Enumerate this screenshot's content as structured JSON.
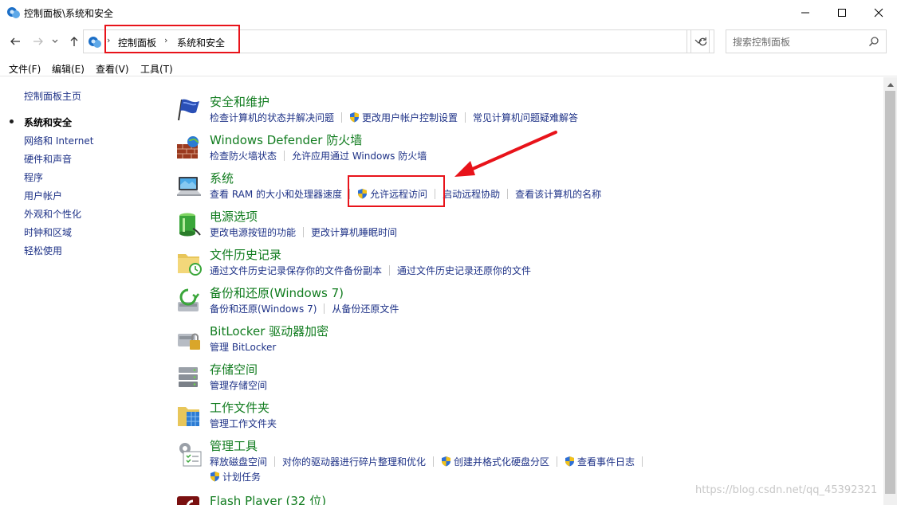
{
  "window": {
    "title": "控制面板\\系统和安全"
  },
  "address": {
    "crumbs": [
      "控制面板",
      "系统和安全"
    ],
    "search_placeholder": "搜索控制面板"
  },
  "menu": [
    "文件(F)",
    "编辑(E)",
    "查看(V)",
    "工具(T)"
  ],
  "sidebar": {
    "home": "控制面板主页",
    "items": [
      {
        "label": "系统和安全",
        "current": true
      },
      {
        "label": "网络和 Internet"
      },
      {
        "label": "硬件和声音"
      },
      {
        "label": "程序"
      },
      {
        "label": "用户帐户"
      },
      {
        "label": "外观和个性化"
      },
      {
        "label": "时钟和区域"
      },
      {
        "label": "轻松使用"
      }
    ]
  },
  "categories": [
    {
      "title": "安全和维护",
      "links": [
        {
          "label": "检查计算机的状态并解决问题"
        },
        {
          "label": "更改用户帐户控制设置",
          "shield": true
        },
        {
          "label": "常见计算机问题疑难解答"
        }
      ]
    },
    {
      "title": "Windows Defender 防火墙",
      "links": [
        {
          "label": "检查防火墙状态"
        },
        {
          "label": "允许应用通过 Windows 防火墙"
        }
      ]
    },
    {
      "title": "系统",
      "links": [
        {
          "label": "查看 RAM 的大小和处理器速度"
        },
        {
          "label": "允许远程访问",
          "shield": true
        },
        {
          "label": "启动远程协助"
        },
        {
          "label": "查看该计算机的名称"
        }
      ]
    },
    {
      "title": "电源选项",
      "links": [
        {
          "label": "更改电源按钮的功能"
        },
        {
          "label": "更改计算机睡眠时间"
        }
      ]
    },
    {
      "title": "文件历史记录",
      "links": [
        {
          "label": "通过文件历史记录保存你的文件备份副本"
        },
        {
          "label": "通过文件历史记录还原你的文件"
        }
      ]
    },
    {
      "title": "备份和还原(Windows 7)",
      "links": [
        {
          "label": "备份和还原(Windows 7)"
        },
        {
          "label": "从备份还原文件"
        }
      ]
    },
    {
      "title": "BitLocker 驱动器加密",
      "links": [
        {
          "label": "管理 BitLocker"
        }
      ]
    },
    {
      "title": "存储空间",
      "links": [
        {
          "label": "管理存储空间"
        }
      ]
    },
    {
      "title": "工作文件夹",
      "links": [
        {
          "label": "管理工作文件夹"
        }
      ]
    },
    {
      "title": "管理工具",
      "links": [
        {
          "label": "释放磁盘空间"
        },
        {
          "label": "对你的驱动器进行碎片整理和优化"
        },
        {
          "label": "创建并格式化硬盘分区",
          "shield": true
        },
        {
          "label": "查看事件日志",
          "shield": true
        }
      ],
      "links2": [
        {
          "label": "计划任务",
          "shield": true
        }
      ]
    },
    {
      "title": "Flash Player (32 位)",
      "links": []
    }
  ],
  "watermark": "https://blog.csdn.net/qq_45392321",
  "colors": {
    "category_title": "#117c1f",
    "link": "#1e3287",
    "highlight": "#e8131a"
  }
}
